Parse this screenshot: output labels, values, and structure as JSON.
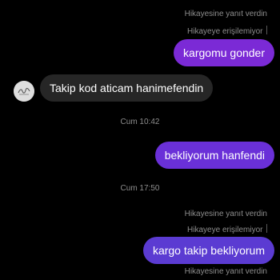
{
  "theme": {
    "background": "#000000",
    "incoming_bubble": "#262626",
    "outgoing_bubble_1": "#7b2ad6",
    "outgoing_bubble_2": "#6a30d8",
    "outgoing_bubble_3": "#5b3bd2",
    "meta_text": "#8e8e8e"
  },
  "messages": [
    {
      "reply_note": "Hikayesine yanıt verdin",
      "story_status": "Hikayeye erişilemiyor",
      "text": "kargomu gonder",
      "direction": "outgoing"
    },
    {
      "text": "Takip kod aticam hanimefendin",
      "direction": "incoming",
      "avatar_icon": "profile-avatar-icon"
    },
    {
      "timestamp": "Cum 10:42"
    },
    {
      "text": "bekliyorum hanfendi",
      "direction": "outgoing"
    },
    {
      "timestamp": "Cum 17:50"
    },
    {
      "reply_note": "Hikayesine yanıt verdin",
      "story_status": "Hikayeye erişilemiyor",
      "text": "kargo takip bekliyorum",
      "direction": "outgoing"
    },
    {
      "reply_note": "Hikayesine yanıt verdin"
    }
  ]
}
